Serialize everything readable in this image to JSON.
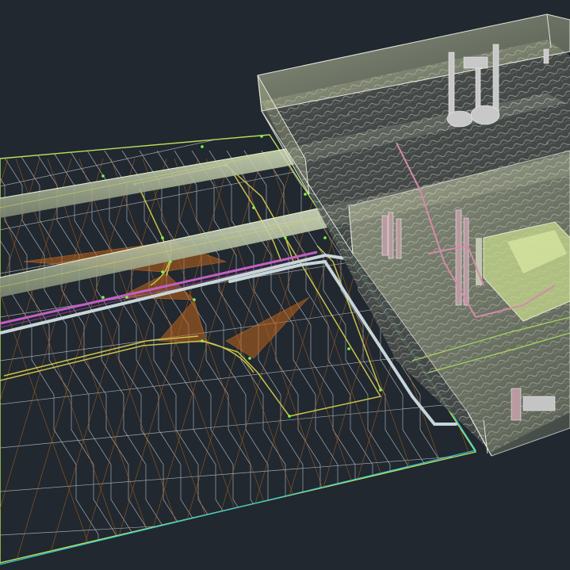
{
  "viewport": {
    "background": "#212830",
    "colors": {
      "terrain_mesh": "#b9bcc0",
      "triangulation": "#b5651d",
      "fill_slope": "#c0621c",
      "boundary_cyan": "#31c9d6",
      "boundary_green": "#b8e05a",
      "road_edge_yellow": "#c9c24a",
      "pipe_light": "#d7e8b8",
      "pipe_magenta": "#c55fc6",
      "node_green": "#7cff4a",
      "building_glass": "#d8e0a8",
      "building_edge": "#e4e6dc"
    },
    "objects": [
      {
        "name": "terrain-surface",
        "icon": "mesh"
      },
      {
        "name": "road-corridor",
        "icon": "polyline"
      },
      {
        "name": "utility-pipes",
        "icon": "pipe"
      },
      {
        "name": "structure-block",
        "icon": "box"
      }
    ]
  }
}
